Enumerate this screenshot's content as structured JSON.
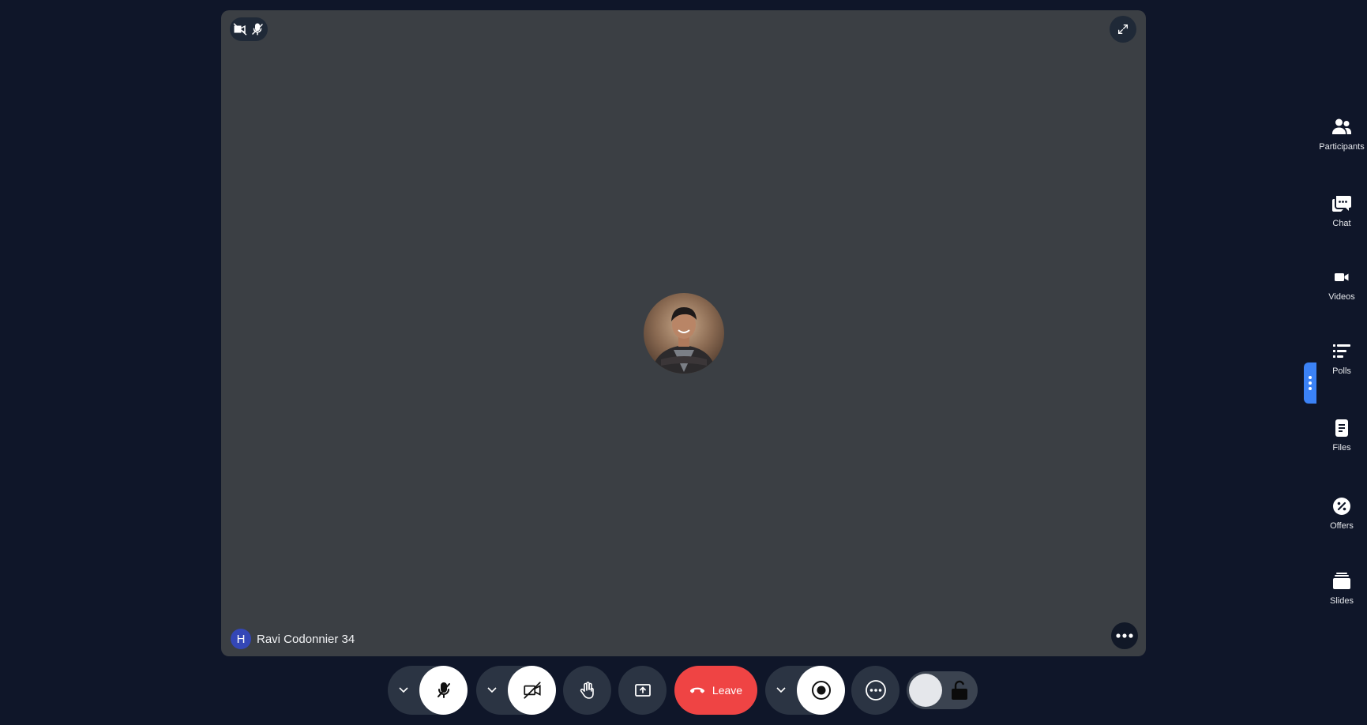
{
  "stage": {
    "participant_initial": "H",
    "participant_name": "Ravi Codonnier 34"
  },
  "icons": {
    "camera_off": "video-off-icon",
    "mic_off": "mic-off-icon",
    "expand": "expand-icon",
    "more": "more-horizontal-icon"
  },
  "controls": {
    "leave_label": "Leave"
  },
  "sidebar": {
    "items": [
      {
        "label": "Participants",
        "icon": "participants-icon"
      },
      {
        "label": "Chat",
        "icon": "chat-icon"
      },
      {
        "label": "Videos",
        "icon": "video-icon"
      },
      {
        "label": "Polls",
        "icon": "polls-icon"
      },
      {
        "label": "Files",
        "icon": "files-icon"
      },
      {
        "label": "Offers",
        "icon": "offers-icon"
      },
      {
        "label": "Slides",
        "icon": "slides-icon"
      }
    ]
  },
  "colors": {
    "background": "#0f1629",
    "stage": "#3b3f44",
    "leave": "#ef4444",
    "accent": "#3b82f6",
    "initial_badge": "#3447b6"
  }
}
